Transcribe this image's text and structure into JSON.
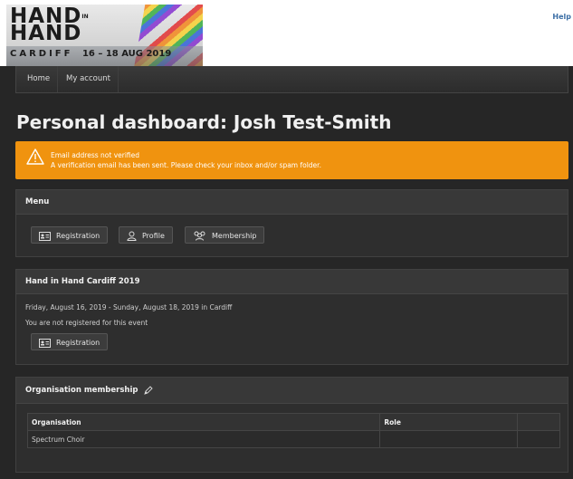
{
  "header": {
    "logo": {
      "line1": "HAND",
      "in": "IN",
      "line2": "HAND",
      "city": "CARDIFF",
      "dates": "16 – 18 AUG 2019"
    },
    "help_label": "Help"
  },
  "nav": {
    "items": [
      {
        "label": "Home"
      },
      {
        "label": "My account"
      }
    ]
  },
  "page_title": "Personal dashboard: Josh Test-Smith",
  "alert": {
    "title": "Email address not verified",
    "message": "A verification email has been sent. Please check your inbox and/or spam folder.",
    "color": "#f0930f"
  },
  "menu_panel": {
    "title": "Menu",
    "buttons": [
      {
        "label": "Registration",
        "icon": "id-card-icon"
      },
      {
        "label": "Profile",
        "icon": "user-icon"
      },
      {
        "label": "Membership",
        "icon": "users-icon"
      }
    ]
  },
  "event_panel": {
    "title": "Hand in Hand Cardiff 2019",
    "dates": "Friday, August 16, 2019 - Sunday, August 18, 2019 in Cardiff",
    "status": "You are not registered for this event",
    "button_label": "Registration"
  },
  "org_panel": {
    "title": "Organisation membership",
    "columns": [
      "Organisation",
      "Role",
      ""
    ],
    "rows": [
      [
        "Spectrum Choir",
        "",
        ""
      ]
    ]
  }
}
